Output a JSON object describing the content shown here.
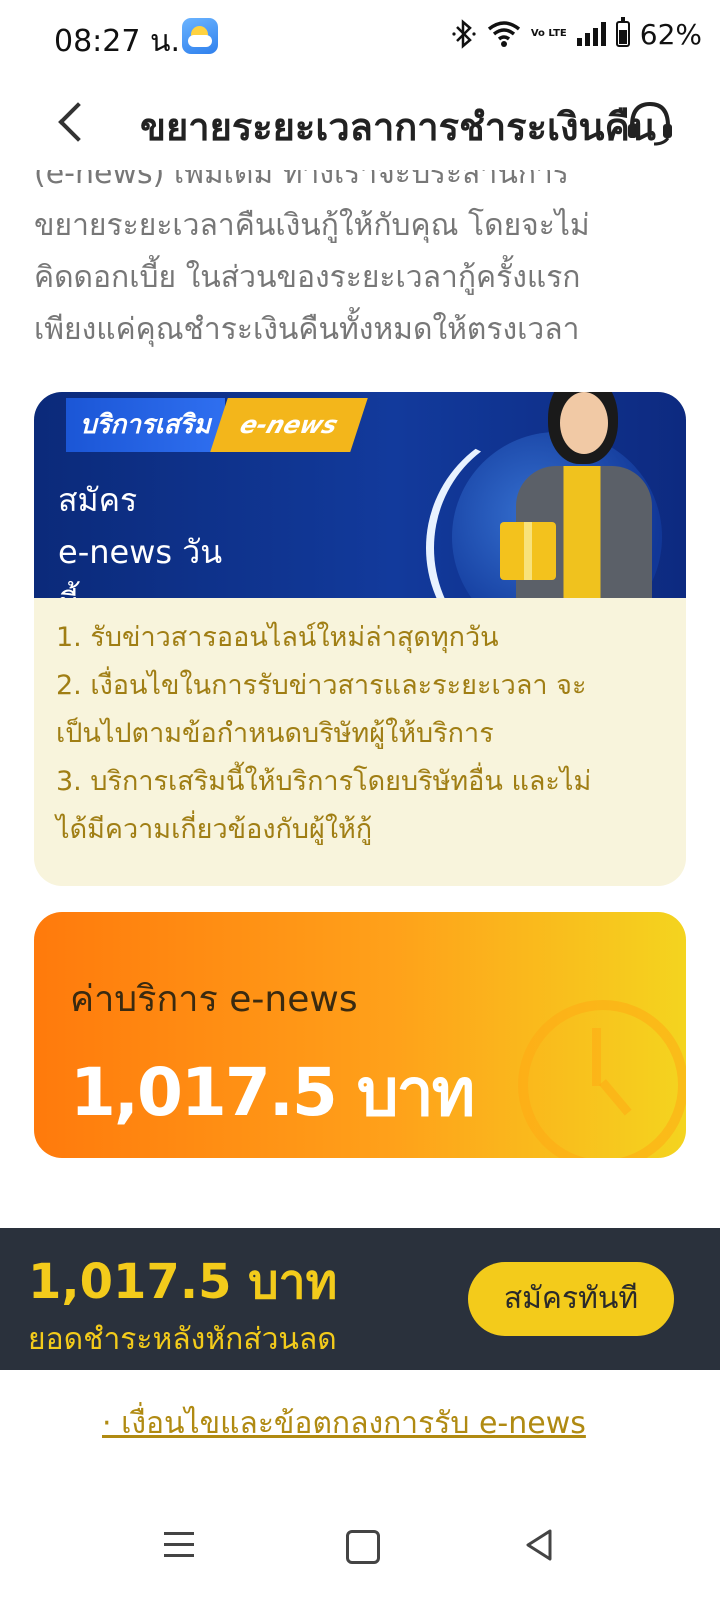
{
  "status_bar": {
    "time": "08:27 น.",
    "battery": "62%",
    "battery_level": 0.62,
    "icons": [
      "weather-app-icon",
      "bluetooth-icon",
      "wifi-icon",
      "volte-icon",
      "signal-icon",
      "battery-icon"
    ],
    "volte_label": "Vo LTE"
  },
  "header": {
    "title": "ขยายระยะเวลาการชำระเงินคืน",
    "back_icon": "chevron-left-icon",
    "support_icon": "headset-icon"
  },
  "intro": {
    "lines": [
      "(e-news) เพิ่มเติม ทางเราจะประสานการ",
      "ขยายระยะเวลาคืนเงินกู้ให้กับคุณ โดยจะไม่",
      "คิดดอกเบี้ย ในส่วนของระยะเวลากู้ครั้งแรก",
      "เพียงแค่คุณชำระเงินคืนทั้งหมดให้ตรงเวลา"
    ]
  },
  "promo": {
    "tag_service": "บริการเสริม",
    "tag_enews": "e-news",
    "banner_lines": [
      "สมัคร",
      "e-news วัน",
      "นี้"
    ],
    "items": [
      "1. รับข่าวสารออนไลน์ใหม่ล่าสุดทุกวัน",
      "2. เงื่อนไขในการรับข่าวสารและระยะเวลา จะ",
      "เป็นไปตามข้อกำหนดบริษัทผู้ให้บริการ",
      "3. บริการเสริมนี้ให้บริการโดยบริษัทอื่น และไม่",
      "ได้มีความเกี่ยวข้องกับผู้ให้กู้"
    ]
  },
  "fee": {
    "label": "ค่าบริการ e-news",
    "amount": "1,017.5 บาท",
    "icon": "clock-history-icon"
  },
  "bottom_bar": {
    "total": "1,017.5 บาท",
    "total_label": "ยอดชำระหลังหักส่วนลด",
    "register_button": "สมัครทันที"
  },
  "terms_link": "· เงื่อนไขและข้อตกลงการรับ e-news",
  "nav": {
    "icons": [
      "recent-apps-icon",
      "home-icon",
      "back-icon"
    ]
  },
  "colors": {
    "accent_yellow": "#f3cb1b",
    "bottom_bar_bg": "#2a313c",
    "promo_text": "#a07e14",
    "fee_gradient_start": "#ff7a0c",
    "fee_gradient_end": "#f4d41f",
    "banner_blue": "#123a9c"
  }
}
